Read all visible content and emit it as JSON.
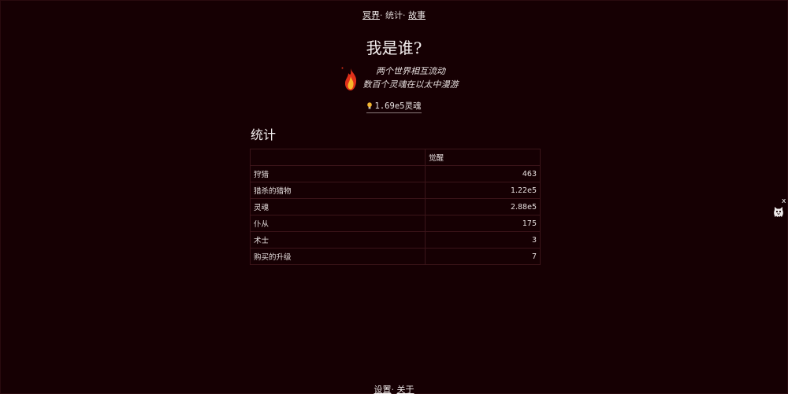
{
  "nav": {
    "link1": "冥界",
    "sep1": "· ",
    "item2": "统计",
    "sep2": "· ",
    "link3": "故事"
  },
  "header": {
    "title": "我是谁?",
    "subtitle_line1": "两个世界相互流动",
    "subtitle_line2": "数百个灵魂在以太中漫游"
  },
  "resource": {
    "amount": "1.69e5",
    "unit": "灵魂"
  },
  "stats": {
    "heading": "统计",
    "column_header": "觉醒",
    "rows": [
      {
        "label": "狩猎",
        "value": "463"
      },
      {
        "label": "猎杀的猎物",
        "value": "1.22e5"
      },
      {
        "label": "灵魂",
        "value": "2.88e5"
      },
      {
        "label": "仆从",
        "value": "175"
      },
      {
        "label": "术士",
        "value": "3"
      },
      {
        "label": "购买的升级",
        "value": "7"
      }
    ]
  },
  "footer": {
    "settings": "设置",
    "sep": "· ",
    "about": "关于"
  },
  "widget": {
    "close": "x"
  },
  "colors": {
    "background": "#160003",
    "text": "#e8e1e1",
    "table_border": "#3b1419",
    "flame_outer": "#e0301a",
    "flame_inner": "#f6b52a"
  },
  "icons": [
    "flame-icon",
    "lightbulb-icon",
    "ghost-icon",
    "close-icon"
  ]
}
